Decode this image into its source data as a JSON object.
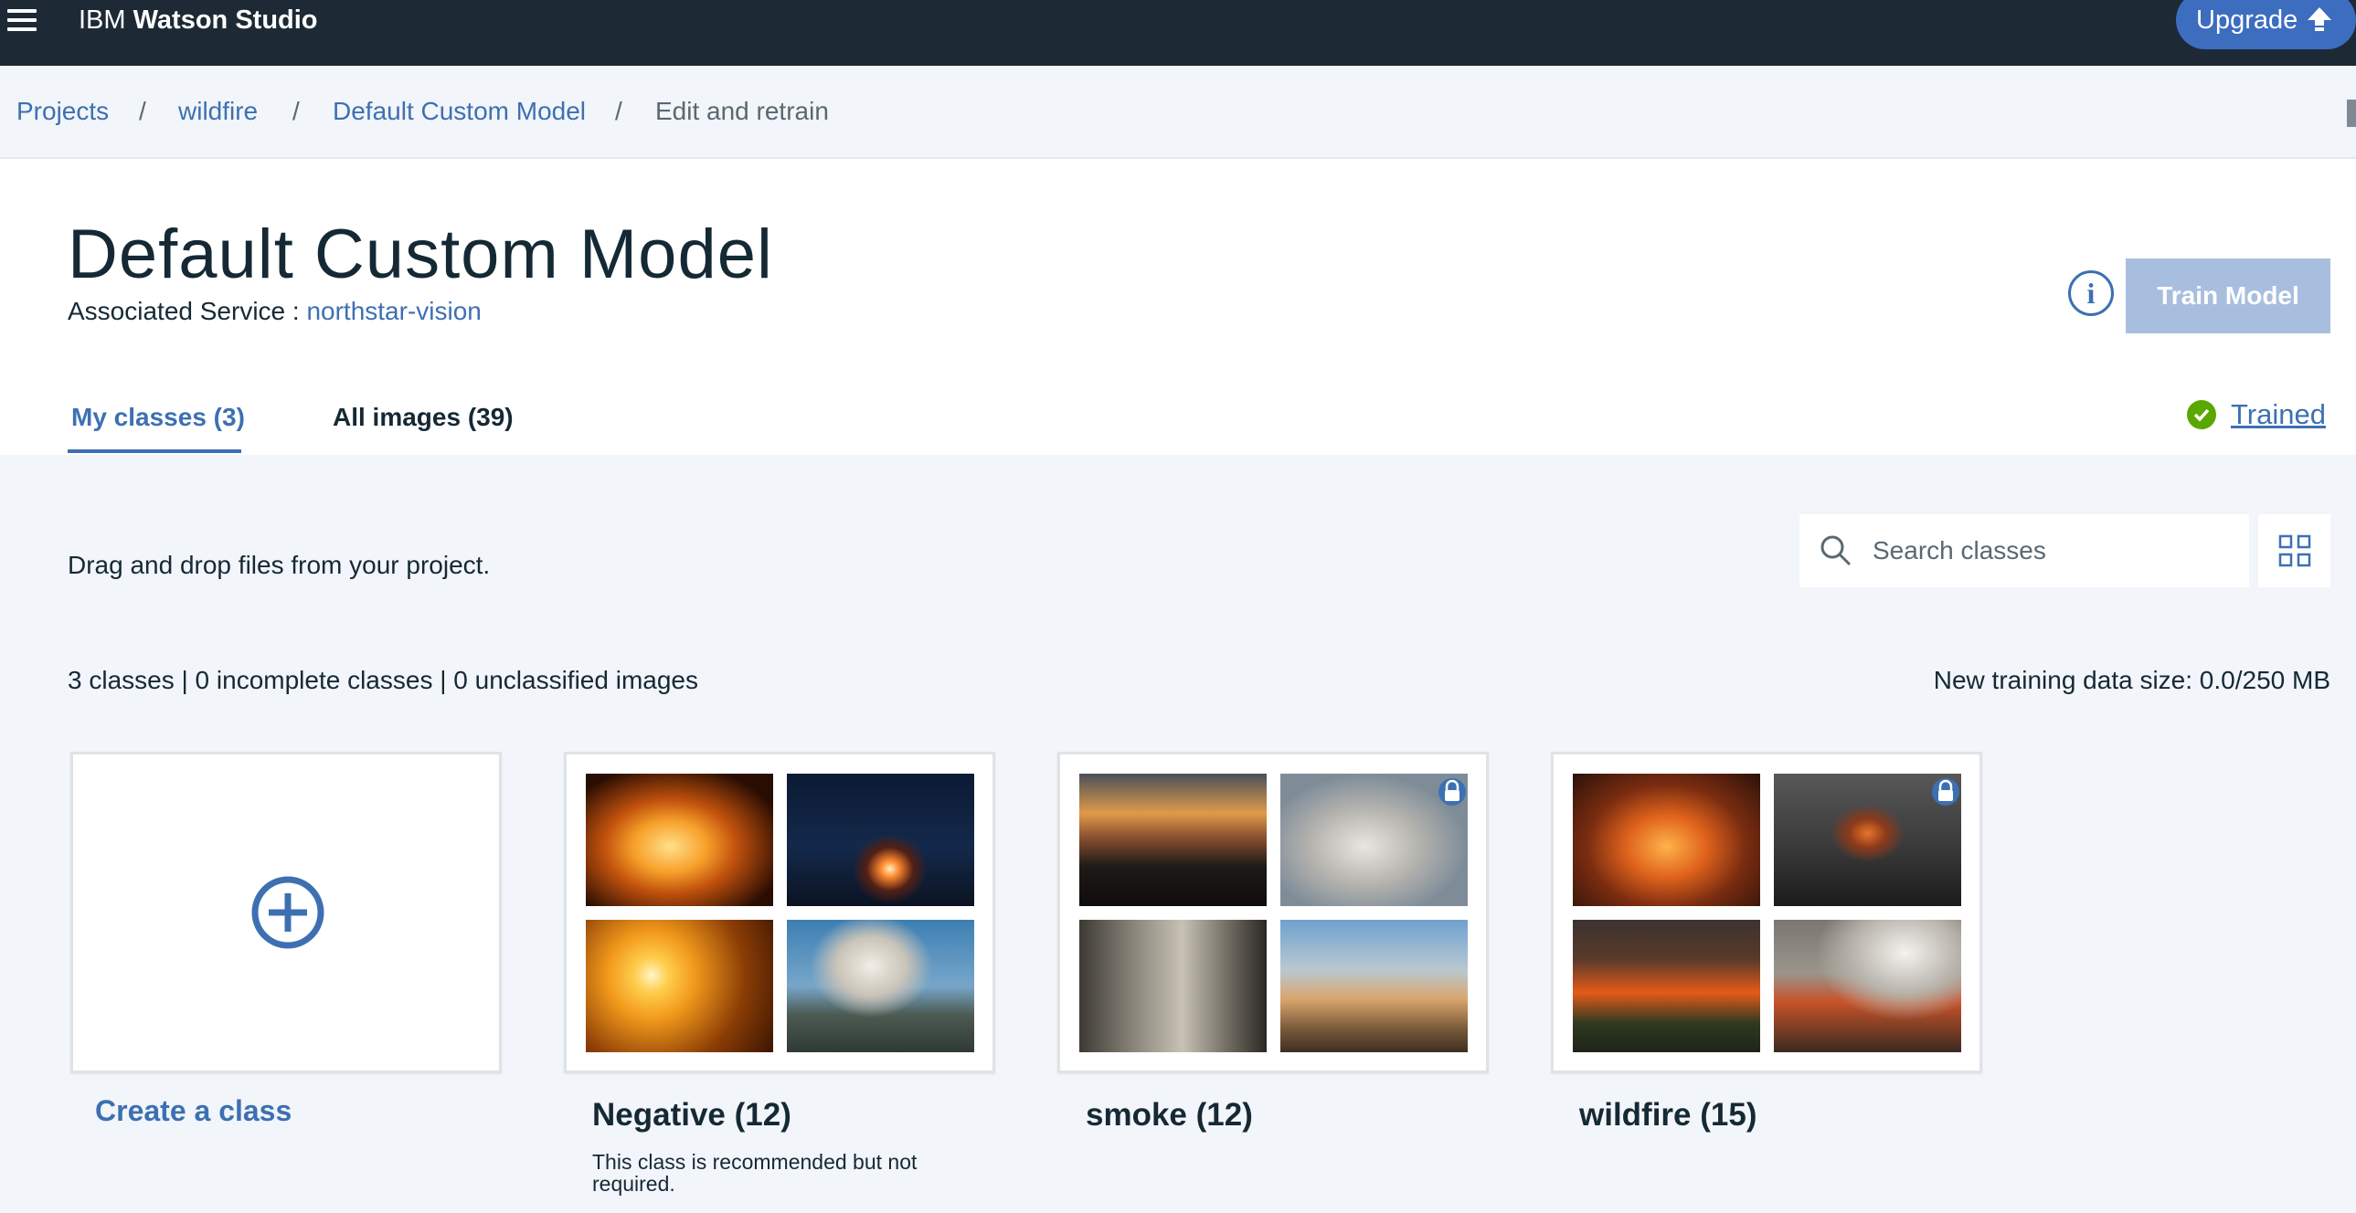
{
  "app": {
    "brand_prefix": "IBM",
    "brand_name": "Watson Studio",
    "upgrade_label": "Upgrade"
  },
  "breadcrumb": {
    "items": [
      "Projects",
      "wildfire",
      "Default Custom Model",
      "Edit and retrain"
    ],
    "separator": "/"
  },
  "header": {
    "title": "Default Custom Model",
    "associated_label": "Associated Service :",
    "associated_service": "northstar-vision",
    "info_glyph": "i",
    "train_button": "Train Model",
    "status": "Trained"
  },
  "tabs": [
    {
      "label": "My classes (3)",
      "active": true
    },
    {
      "label": "All images (39)",
      "active": false
    }
  ],
  "content": {
    "drag_text": "Drag and drop files from your project.",
    "search_placeholder": "Search classes",
    "stats": "3 classes | 0 incomplete classes | 0 unclassified images",
    "data_size": "New training data size: 0.0/250 MB",
    "create_label": "Create a class"
  },
  "classes": [
    {
      "name": "Negative (12)",
      "note": "This class is recommended but not required.",
      "thumbnails": [
        "campfire-flames",
        "night-hillside-fire",
        "wheat-sunset",
        "mountain-smoke-plume"
      ]
    },
    {
      "name": "smoke (12)",
      "thumbnails": [
        "sunset-mountains",
        "smoke-slope",
        "misty-forest",
        "rural-haze"
      ]
    },
    {
      "name": "wildfire (15)",
      "thumbnails": [
        "orange-forest-fire",
        "burning-tree",
        "fire-line-forest",
        "white-smoke-fire"
      ]
    }
  ],
  "colors": {
    "topbar": "#1d2a36",
    "accent": "#3d70b2",
    "success": "#5aa700",
    "train_disabled": "#a8bedf"
  },
  "icons": [
    "menu-icon",
    "upgrade-arrow-icon",
    "info-icon",
    "check-circle-icon",
    "search-icon",
    "grid-view-icon",
    "add-circle-icon",
    "lock-icon"
  ]
}
